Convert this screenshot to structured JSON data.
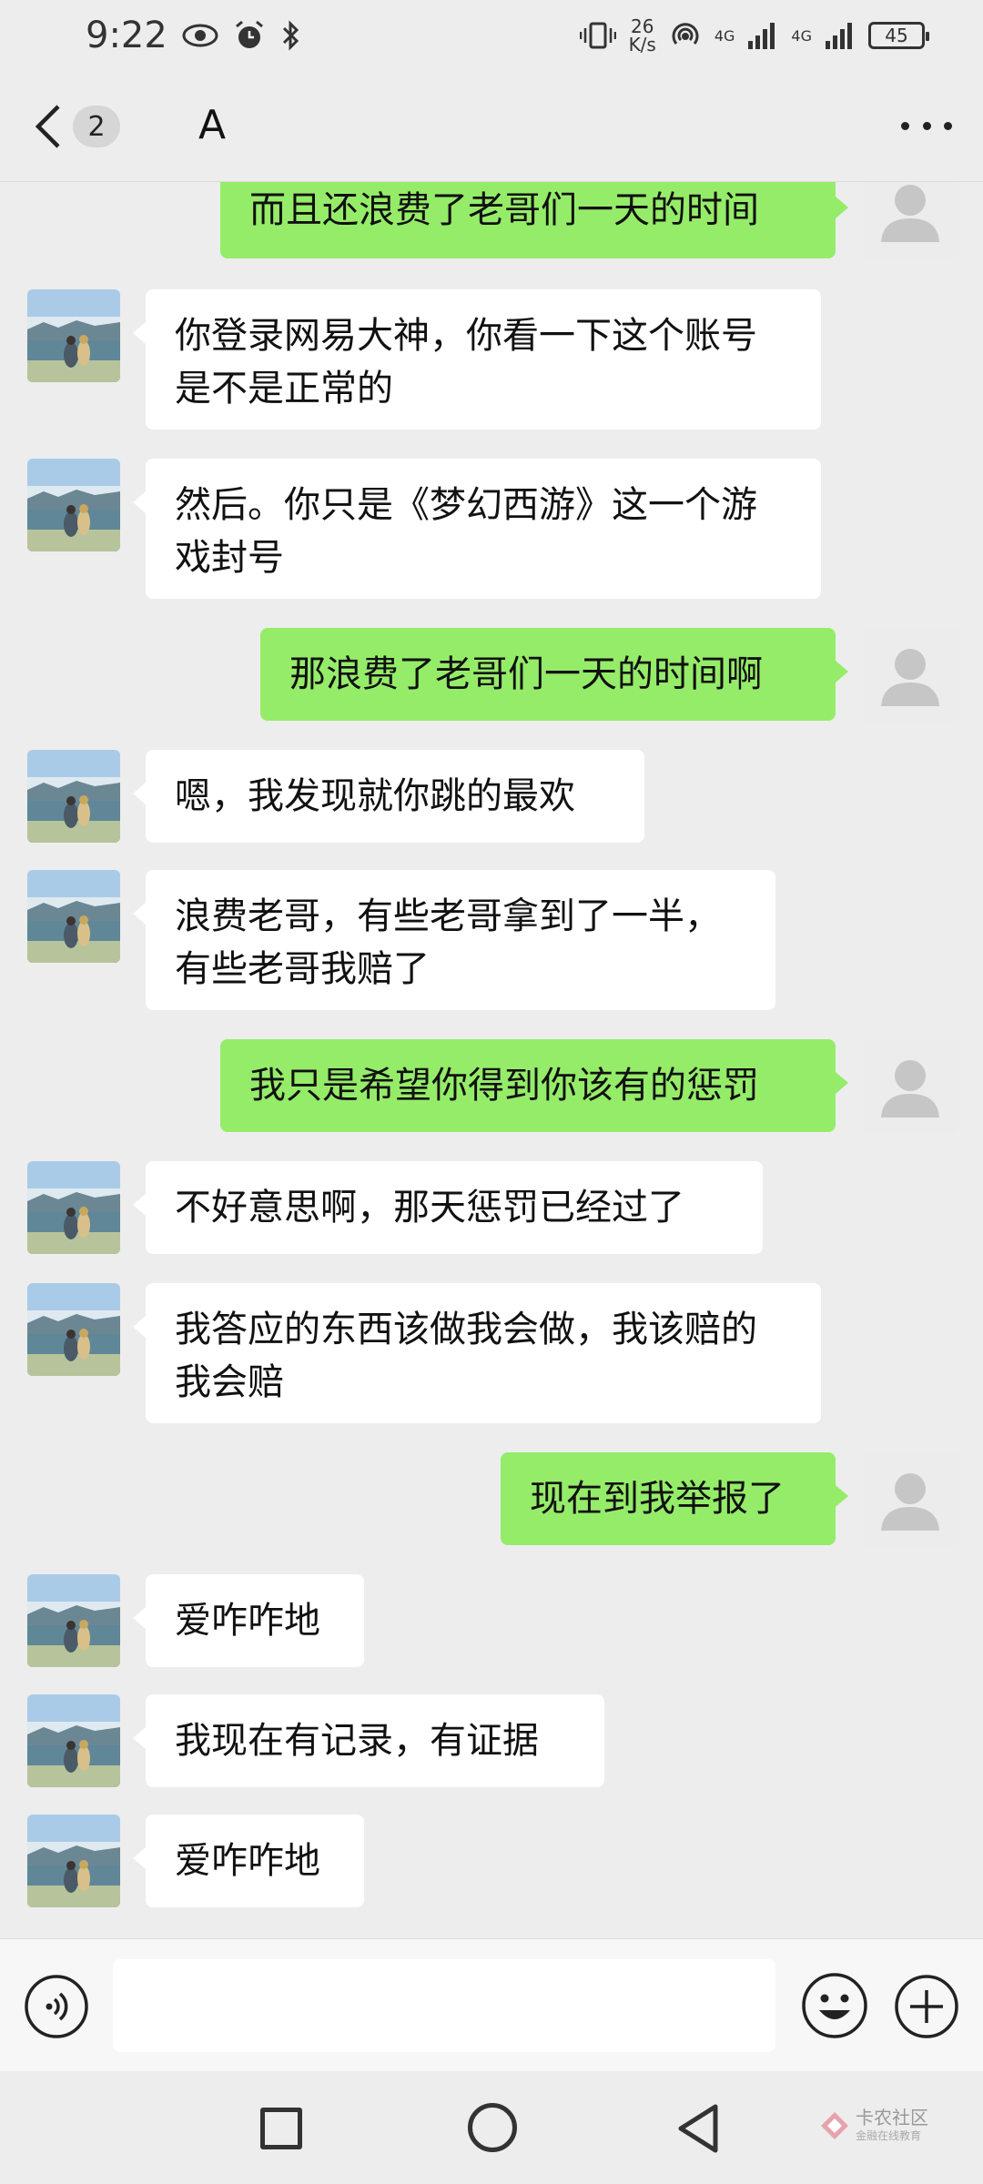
{
  "status_bar": {
    "time": "9:22",
    "speed_value": "26",
    "speed_unit": "K/s",
    "network_1": "4G",
    "network_2": "4G",
    "battery": "45"
  },
  "header": {
    "unread_count": "2",
    "title": "A"
  },
  "messages": [
    {
      "side": "out",
      "text": "而且还浪费了老哥们一天的时间"
    },
    {
      "side": "in",
      "text": "你登录网易大神，你看一下这个账号是不是正常的"
    },
    {
      "side": "in",
      "text": "然后。你只是《梦幻西游》这一个游戏封号"
    },
    {
      "side": "out",
      "text": "那浪费了老哥们一天的时间啊"
    },
    {
      "side": "in",
      "text": "嗯，我发现就你跳的最欢"
    },
    {
      "side": "in",
      "text": "浪费老哥，有些老哥拿到了一半，有些老哥我赔了"
    },
    {
      "side": "out",
      "text": "我只是希望你得到你该有的惩罚"
    },
    {
      "side": "in",
      "text": "不好意思啊，那天惩罚已经过了"
    },
    {
      "side": "in",
      "text": "我答应的东西该做我会做，我该赔的我会赔"
    },
    {
      "side": "out",
      "text": "现在到我举报了"
    },
    {
      "side": "in",
      "text": "爱咋咋地"
    },
    {
      "side": "in",
      "text": "我现在有记录，有证据"
    },
    {
      "side": "in",
      "text": "爱咋咋地"
    }
  ],
  "input": {
    "value": ""
  },
  "watermark": {
    "title": "卡农社区",
    "subtitle": "金融在线教育"
  },
  "colors": {
    "outgoing_bubble": "#95ec69",
    "incoming_bubble": "#ffffff",
    "background": "#ededed"
  }
}
